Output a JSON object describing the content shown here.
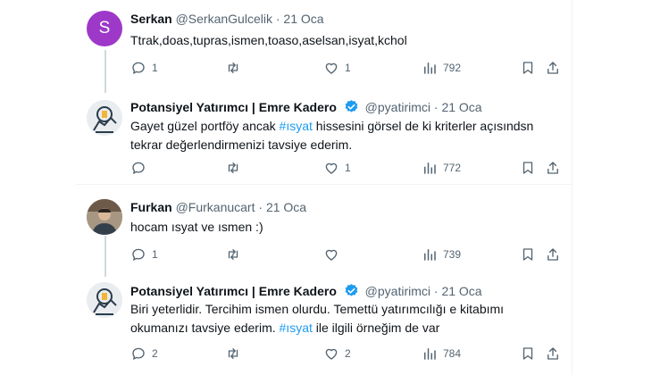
{
  "tweets": [
    {
      "name": "Serkan",
      "handle": "@SerkanGulcelik",
      "date": "21 Oca",
      "avatar_letter": "S",
      "text": "Ttrak,doas,tupras,ismen,toaso,aselsan,isyat,kchol",
      "replies": "1",
      "retweets": "",
      "likes": "1",
      "views": "792"
    },
    {
      "name": "Potansiyel Yatırımcı | Emre Kadero",
      "handle": "@pyatirimci",
      "date": "21 Oca",
      "verified": true,
      "text_before": "Gayet güzel portföy ancak ",
      "hashtag": "#ısyat",
      "text_after": " hissesini görsel de ki kriterler açısındsn tekrar değerlendirmenizi tavsiye ederim.",
      "replies": "",
      "retweets": "",
      "likes": "1",
      "views": "772"
    },
    {
      "name": "Furkan",
      "handle": "@Furkanucart",
      "date": "21 Oca",
      "text": "hocam ısyat ve ısmen :)",
      "replies": "1",
      "retweets": "",
      "likes": "",
      "views": "739"
    },
    {
      "name": "Potansiyel Yatırımcı | Emre Kadero",
      "handle": "@pyatirimci",
      "date": "21 Oca",
      "verified": true,
      "text_before": "Biri yeterlidir. Tercihim ismen olurdu. Temettü yatırımcılığı e kitabımı okumanızı tavsiye ederim. ",
      "hashtag": "#ısyat",
      "text_after": " ile ilgili örneğim de var",
      "replies": "2",
      "retweets": "",
      "likes": "2",
      "views": "784"
    }
  ],
  "separator": "·",
  "colors": {
    "accent": "#1d9bf0",
    "muted": "#536471",
    "avatar_serkan": "#9d38c9"
  },
  "icons": [
    "reply-icon",
    "retweet-icon",
    "like-icon",
    "views-icon",
    "bookmark-icon",
    "share-icon",
    "verified-badge-icon"
  ]
}
